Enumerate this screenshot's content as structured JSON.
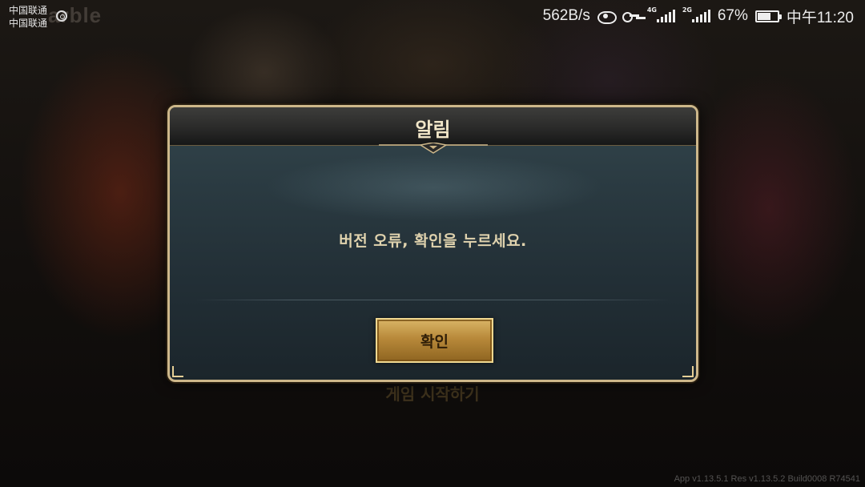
{
  "status_bar": {
    "carrier_1": "中国联通",
    "carrier_2": "中国联通",
    "network_speed": "562B/s",
    "signal_1_type": "4G",
    "signal_2_type": "2G",
    "battery_percent": "67%",
    "battery_level": 0.67,
    "time": "中午11:20",
    "icons": [
      "nfc-icon",
      "eye-icon",
      "key-icon",
      "signal-icon",
      "battery-icon"
    ]
  },
  "background": {
    "logo_text": "arble",
    "start_game_label": "게임 시작하기",
    "build_info": "App v1.13.5.1 Res v1.13.5.2 Build0008 R74541"
  },
  "dialog": {
    "title": "알림",
    "message": "버전 오류, 확인을 누르세요.",
    "confirm_label": "확인",
    "accent_color": "#cdb78a",
    "button_color": "#b8893a"
  }
}
